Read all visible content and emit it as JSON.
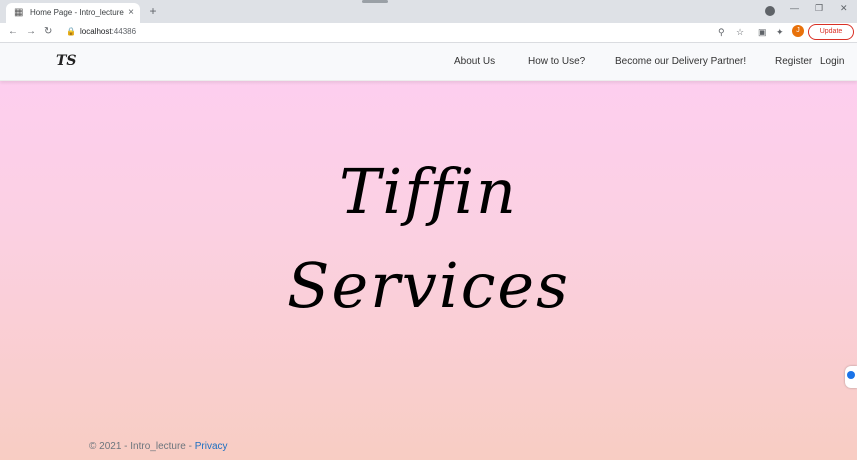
{
  "browser": {
    "tab_title": "Home Page - Intro_lecture",
    "tab_close": "×",
    "new_tab": "+",
    "address_host": "localhost",
    "address_port": ":44386",
    "update_label": "Update",
    "avatar_initial": "J"
  },
  "navbar": {
    "brand": "TS",
    "links": [
      "About Us",
      "How to Use?",
      "Become our Delivery Partner!",
      "Register",
      "Login"
    ]
  },
  "hero": {
    "line1": "Tiffin",
    "line2": "Services"
  },
  "footer": {
    "copyright": "© 2021 - Intro_lecture - ",
    "privacy": "Privacy"
  }
}
